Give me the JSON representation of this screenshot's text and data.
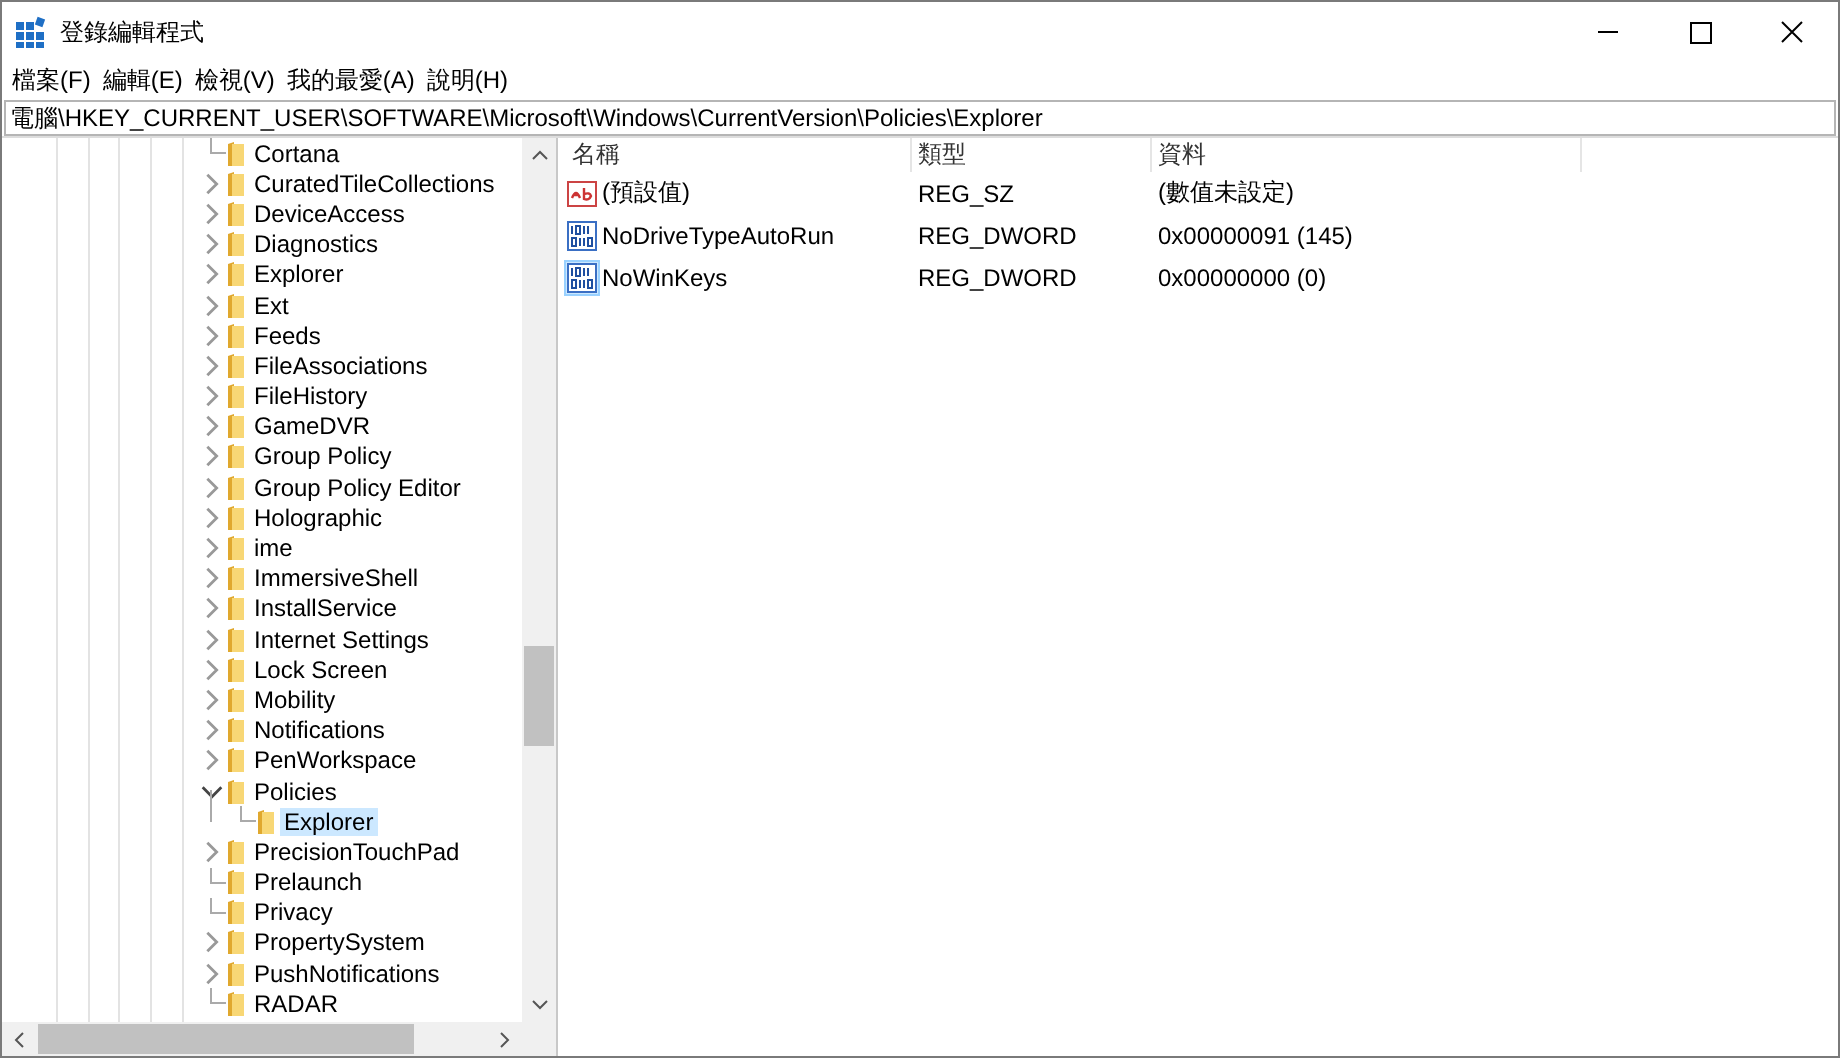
{
  "window": {
    "title": "登錄編輯程式"
  },
  "menu": [
    "檔案(F)",
    "編輯(E)",
    "檢視(V)",
    "我的最愛(A)",
    "說明(H)"
  ],
  "address": "電腦\\HKEY_CURRENT_USER\\SOFTWARE\\Microsoft\\Windows\\CurrentVersion\\Policies\\Explorer",
  "tree": [
    {
      "label": "Cortana",
      "kind": "leaf",
      "selected": false
    },
    {
      "label": "CuratedTileCollections",
      "kind": "collapsed",
      "selected": false
    },
    {
      "label": "DeviceAccess",
      "kind": "collapsed",
      "selected": false
    },
    {
      "label": "Diagnostics",
      "kind": "collapsed",
      "selected": false
    },
    {
      "label": "Explorer",
      "kind": "collapsed",
      "selected": false
    },
    {
      "label": "Ext",
      "kind": "collapsed",
      "selected": false
    },
    {
      "label": "Feeds",
      "kind": "collapsed",
      "selected": false
    },
    {
      "label": "FileAssociations",
      "kind": "collapsed",
      "selected": false
    },
    {
      "label": "FileHistory",
      "kind": "collapsed",
      "selected": false
    },
    {
      "label": "GameDVR",
      "kind": "collapsed",
      "selected": false
    },
    {
      "label": "Group Policy",
      "kind": "collapsed",
      "selected": false
    },
    {
      "label": "Group Policy Editor",
      "kind": "collapsed",
      "selected": false
    },
    {
      "label": "Holographic",
      "kind": "collapsed",
      "selected": false
    },
    {
      "label": "ime",
      "kind": "collapsed",
      "selected": false
    },
    {
      "label": "ImmersiveShell",
      "kind": "collapsed",
      "selected": false
    },
    {
      "label": "InstallService",
      "kind": "collapsed",
      "selected": false
    },
    {
      "label": "Internet Settings",
      "kind": "collapsed",
      "selected": false
    },
    {
      "label": "Lock Screen",
      "kind": "collapsed",
      "selected": false
    },
    {
      "label": "Mobility",
      "kind": "collapsed",
      "selected": false
    },
    {
      "label": "Notifications",
      "kind": "collapsed",
      "selected": false
    },
    {
      "label": "PenWorkspace",
      "kind": "collapsed",
      "selected": false
    },
    {
      "label": "Policies",
      "kind": "expanded",
      "selected": false,
      "children": [
        {
          "label": "Explorer",
          "kind": "leaf",
          "selected": true
        }
      ]
    },
    {
      "label": "PrecisionTouchPad",
      "kind": "collapsed",
      "selected": false
    },
    {
      "label": "Prelaunch",
      "kind": "leaf",
      "selected": false
    },
    {
      "label": "Privacy",
      "kind": "leaf",
      "selected": false
    },
    {
      "label": "PropertySystem",
      "kind": "collapsed",
      "selected": false
    },
    {
      "label": "PushNotifications",
      "kind": "collapsed",
      "selected": false
    },
    {
      "label": "RADAR",
      "kind": "leaf",
      "selected": false
    }
  ],
  "table": {
    "columns": [
      "名稱",
      "類型",
      "資料"
    ],
    "rows": [
      {
        "kind": "string",
        "name": "(預設值)",
        "type": "REG_SZ",
        "data": "(數值未設定)",
        "selected": false
      },
      {
        "kind": "binary",
        "name": "NoDriveTypeAutoRun",
        "type": "REG_DWORD",
        "data": "0x00000091 (145)",
        "selected": false
      },
      {
        "kind": "binary",
        "name": "NoWinKeys",
        "type": "REG_DWORD",
        "data": "0x00000000 (0)",
        "selected": true
      }
    ]
  }
}
